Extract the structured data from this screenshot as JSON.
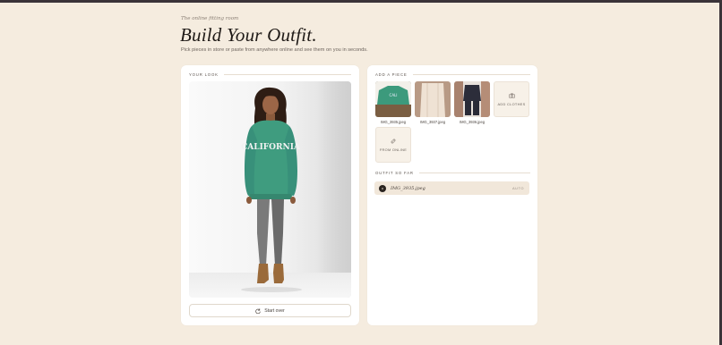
{
  "header": {
    "kicker": "The online fitting room",
    "title": "Build Your Outfit.",
    "subtitle": "Pick pieces in store or paste from anywhere online and see them on you in seconds."
  },
  "your_look": {
    "heading": "YOUR LOOK",
    "model_shirt_text": "CALIFORNIA",
    "start_over_label": "Start over"
  },
  "add_piece": {
    "heading": "ADD A PIECE",
    "thumbnails": [
      {
        "label": "IMG_3935.jpeg",
        "icon": "green-sweatshirt-photo"
      },
      {
        "label": "IMG_3937.jpeg",
        "icon": "beige-jacket-photo"
      },
      {
        "label": "IMG_3936.jpeg",
        "icon": "dark-outfit-photo"
      }
    ],
    "add_clothes_label": "ADD CLOTHES",
    "from_online_label": "FROM ONLINE"
  },
  "outfit": {
    "heading": "OUTFIT SO FAR",
    "items": [
      {
        "name": "IMG_3935.jpeg",
        "tag": "AUTO"
      }
    ]
  },
  "colors": {
    "background": "#f5ecdf",
    "card": "#ffffff",
    "accent_dark": "#2a2420",
    "sweatshirt": "#3f9c7f"
  }
}
